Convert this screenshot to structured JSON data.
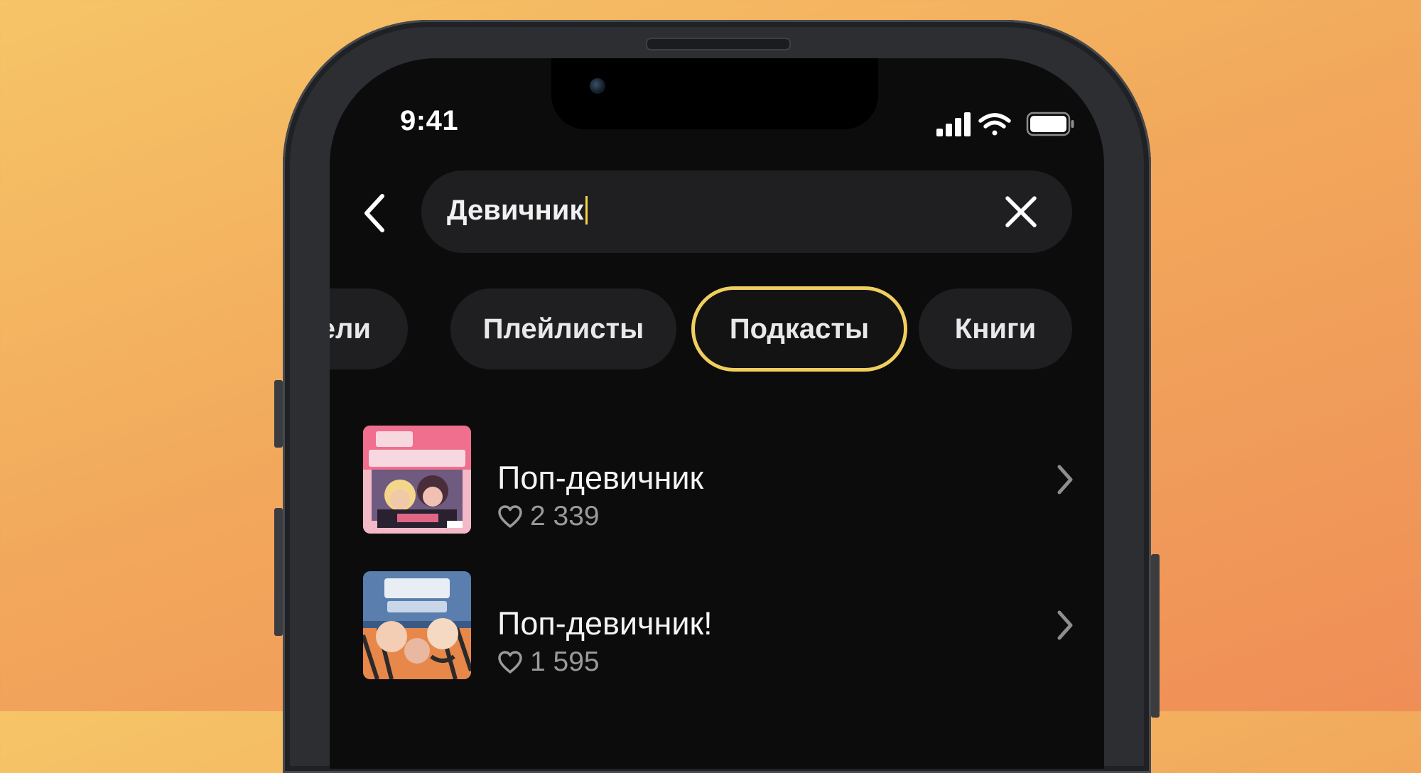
{
  "status_bar": {
    "time": "9:41",
    "icons": [
      "cellular-signal-icon",
      "wifi-icon",
      "battery-icon"
    ]
  },
  "search": {
    "value": "Девичник",
    "back_icon": "chevron-left-icon",
    "clear_icon": "close-icon"
  },
  "filters": {
    "chips": [
      {
        "label": "тели",
        "selected": false
      },
      {
        "label": "Плейлисты",
        "selected": false
      },
      {
        "label": "Подкасты",
        "selected": true
      },
      {
        "label": "Книги",
        "selected": false
      }
    ]
  },
  "results": [
    {
      "title": "Поп-девичник",
      "likes": "2 339"
    },
    {
      "title": "Поп-девичник!",
      "likes": "1 595"
    }
  ],
  "colors": {
    "screen_bg": "#0c0c0d",
    "chip_bg": "#1f1f21",
    "accent": "#f1cf5e",
    "text_primary": "#f4f4f4",
    "text_secondary": "#9a9a9c"
  }
}
